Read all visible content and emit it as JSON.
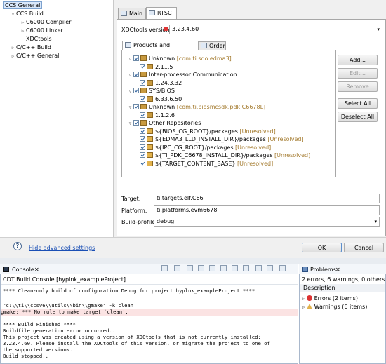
{
  "left_tree": {
    "items": [
      {
        "label": "CCS General",
        "selected": true,
        "twisty": ""
      },
      {
        "label": "CCS Build",
        "twisty": "▿"
      },
      {
        "label": "C6000 Compiler",
        "twisty": "▹"
      },
      {
        "label": "C6000 Linker",
        "twisty": "▹"
      },
      {
        "label": "XDCtools",
        "twisty": ""
      },
      {
        "label": "C/C++ Build",
        "twisty": "▹"
      },
      {
        "label": "C/C++ General",
        "twisty": "▹"
      }
    ]
  },
  "tabs": {
    "main": "Main",
    "rtsc": "RTSC"
  },
  "xdc": {
    "label": "XDCtools version:",
    "value": "3.23.4.60"
  },
  "inner_tabs": {
    "products": "Products and Repositories",
    "order": "Order"
  },
  "repositories": [
    {
      "label": "Unknown",
      "suffix": "[com.ti.sdo.edma3]",
      "level": 0,
      "expand": "▿"
    },
    {
      "label": "2.11.5",
      "level": 1
    },
    {
      "label": "Inter-processor Communication",
      "level": 0,
      "expand": "▿"
    },
    {
      "label": "1.24.3.32",
      "level": 1
    },
    {
      "label": "SYS/BIOS",
      "level": 0,
      "expand": "▿"
    },
    {
      "label": "6.33.6.50",
      "level": 1
    },
    {
      "label": "Unknown",
      "suffix": "[com.ti.biosmcsdk.pdk.C6678L]",
      "level": 0,
      "expand": "▿"
    },
    {
      "label": "1.1.2.6",
      "level": 1
    },
    {
      "label": "Other Repositories",
      "level": 0,
      "expand": "▿"
    },
    {
      "label": "${BIOS_CG_ROOT}/packages",
      "suffix": "[Unresolved]",
      "level": 1,
      "warn": true
    },
    {
      "label": "${EDMA3_LLD_INSTALL_DIR}/packages",
      "suffix": "[Unresolved]",
      "level": 1,
      "warn": true
    },
    {
      "label": "${IPC_CG_ROOT}/packages",
      "suffix": "[Unresolved]",
      "level": 1,
      "warn": true
    },
    {
      "label": "${TI_PDK_C6678_INSTALL_DIR}/packages",
      "suffix": "[Unresolved]",
      "level": 1,
      "warn": true
    },
    {
      "label": "${TARGET_CONTENT_BASE}",
      "suffix": "[Unresolved]",
      "level": 1,
      "warn": true
    }
  ],
  "side_buttons": {
    "add": "Add...",
    "edit": "Edit...",
    "remove": "Remove",
    "select_all": "Select All",
    "deselect_all": "Deselect All"
  },
  "target": {
    "label": "Target:",
    "value": "ti.targets.elf.C66"
  },
  "platform": {
    "label": "Platform:",
    "value": "ti.platforms.evm6678"
  },
  "build_profile": {
    "label": "Build-profile:",
    "value": "debug"
  },
  "footer": {
    "help_icon": "help-icon",
    "hide_advanced": "Hide advanced settings",
    "ok": "OK",
    "cancel": "Cancel"
  },
  "console": {
    "tab_label": "Console",
    "title": "CDT Build Console [hyplnk_exampleProject]",
    "lines": [
      "**** Clean-only build of configuration Debug for project hyplnk_exampleProject ****",
      "",
      "\"c:\\\\ti\\\\ccsv6\\\\utils\\\\bin\\\\gmake\" -k clean",
      "gmake: *** No rule to make target `clean'.",
      "",
      "**** Build Finished ****",
      "Buildfile generation error occurred..",
      "This project was created using a version of XDCtools that is not currently installed:",
      "3.23.4.60. Please install the XDCtools of this version, or migrate the project to one of",
      "the supported versions.",
      "Build stopped.."
    ],
    "error_line_index": 3
  },
  "problems": {
    "tab_label": "Problems",
    "summary": "2 errors, 6 warnings, 0 others",
    "column": "Description",
    "errors": "Errors (2 items)",
    "warnings": "Warnings (6 items)"
  }
}
